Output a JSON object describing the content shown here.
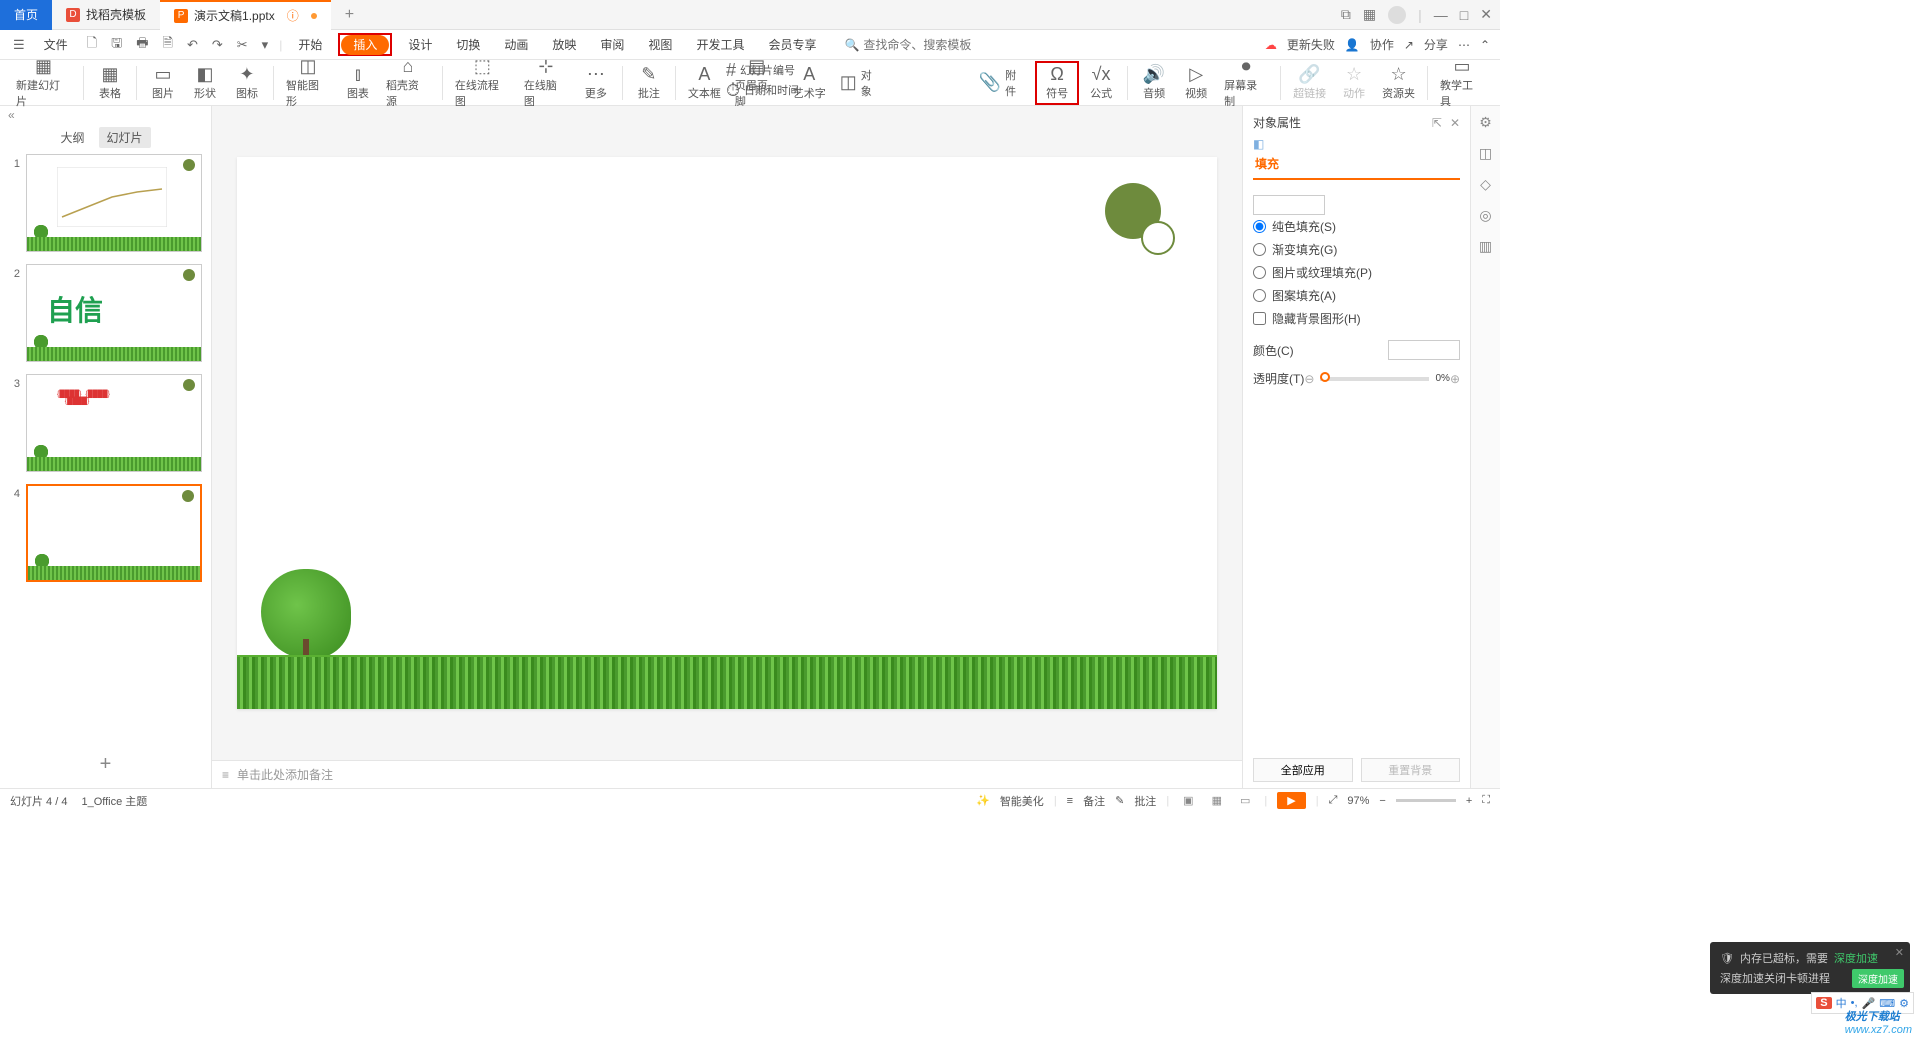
{
  "titlebar": {
    "home": "首页",
    "tab2": "找稻壳模板",
    "tab3": "演示文稿1.pptx",
    "plus": "+"
  },
  "menubar": {
    "file": "文件",
    "items": [
      "开始",
      "插入",
      "设计",
      "切换",
      "动画",
      "放映",
      "审阅",
      "视图",
      "开发工具",
      "会员专享"
    ],
    "search_label": "查找命令、搜索模板",
    "right": {
      "fail": "更新失败",
      "collab": "协作",
      "share": "分享"
    }
  },
  "ribbon": {
    "items": [
      {
        "label": "新建幻灯片",
        "ico": "▦"
      },
      {
        "label": "表格",
        "ico": "▦"
      },
      {
        "label": "图片",
        "ico": "▭"
      },
      {
        "label": "形状",
        "ico": "◧"
      },
      {
        "label": "图标",
        "ico": "✦"
      },
      {
        "label": "智能图形",
        "ico": "◫"
      },
      {
        "label": "图表",
        "ico": "⫾"
      },
      {
        "label": "稻壳资源",
        "ico": "⌂"
      },
      {
        "label": "在线流程图",
        "ico": "⬚"
      },
      {
        "label": "在线脑图",
        "ico": "⊹"
      },
      {
        "label": "更多",
        "ico": "⋯"
      },
      {
        "label": "批注",
        "ico": "✎"
      },
      {
        "label": "文本框",
        "ico": "A"
      },
      {
        "label": "页眉页脚",
        "ico": "▤"
      },
      {
        "label": "艺术字",
        "ico": "A"
      },
      {
        "label": "对象",
        "ico": "◫"
      },
      {
        "label": "幻灯片编号",
        "ico": "#"
      },
      {
        "label": "附件",
        "ico": "📎"
      },
      {
        "label": "日期和时间",
        "ico": "⏱"
      },
      {
        "label": "符号",
        "ico": "Ω"
      },
      {
        "label": "公式",
        "ico": "√x"
      },
      {
        "label": "音频",
        "ico": "🔊"
      },
      {
        "label": "视频",
        "ico": "▷"
      },
      {
        "label": "屏幕录制",
        "ico": "⏺"
      },
      {
        "label": "超链接",
        "ico": "🔗"
      },
      {
        "label": "动作",
        "ico": "☆"
      },
      {
        "label": "资源夹",
        "ico": "☆"
      },
      {
        "label": "教学工具",
        "ico": "▭"
      }
    ]
  },
  "leftpanel": {
    "tab_outline": "大纲",
    "tab_slides": "幻灯片",
    "collapse": "«",
    "add": "+",
    "thumbs": [
      "1",
      "2",
      "3",
      "4"
    ],
    "thumb2_text": "自信"
  },
  "notes": {
    "placeholder": "单击此处添加备注"
  },
  "rightpanel": {
    "title": "对象属性",
    "tab_fill": "填充",
    "section": "填充",
    "opts": {
      "solid": "纯色填充(S)",
      "gradient": "渐变填充(G)",
      "picture": "图片或纹理填充(P)",
      "pattern": "图案填充(A)",
      "hidebg": "隐藏背景图形(H)"
    },
    "color_label": "颜色(C)",
    "alpha_label": "透明度(T)",
    "alpha_val": "0%",
    "btn_all": "全部应用",
    "btn_reset": "重置背景"
  },
  "status": {
    "slide": "幻灯片 4 / 4",
    "theme": "1_Office 主题",
    "beautify": "智能美化",
    "notes": "备注",
    "comments": "批注",
    "zoom": "97%"
  },
  "toast": {
    "line1a": "内存已超标，需要",
    "line1b": "深度加速",
    "line2": "深度加速关闭卡顿进程",
    "btn": "深度加速"
  },
  "ime": {
    "logo": "S",
    "a": "中",
    "b": "•,",
    "c": "🎤",
    "d": "⌨",
    "e": "⚙"
  },
  "watermark": {
    "a": "极光下载站",
    "b": "www.xz7.com"
  }
}
